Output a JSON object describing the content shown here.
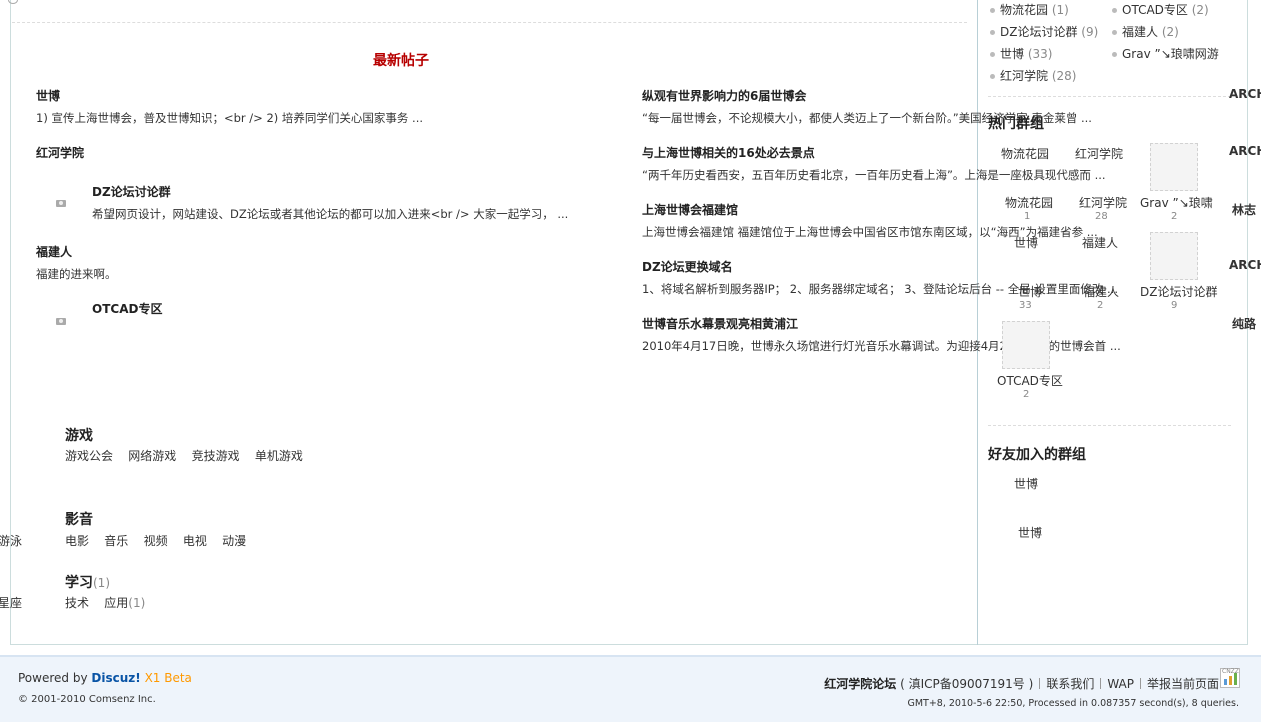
{
  "left": {
    "new_posts_title": "最新帖子",
    "posts_left": [
      {
        "title": "世博",
        "desc": "1) 宣传上海世博会，普及世博知识；<br /> 2) 培养同学们关心国家事务 ..."
      },
      {
        "title": "红河学院",
        "desc": ""
      },
      {
        "title": "DZ论坛讨论群",
        "desc": "希望网页设计，网站建设、DZ论坛或者其他论坛的都可以加入进来<br /> 大家一起学习， ..."
      },
      {
        "title": "福建人",
        "desc": "福建的进来啊。"
      },
      {
        "title": "OTCAD专区",
        "desc": ""
      }
    ],
    "posts_right": [
      {
        "title": "纵观有世界影响力的6届世博会",
        "desc": "“每一届世博会，不论规模大小，都使人类迈上了一个新台阶。”美国经济学家 麦金莱曾 ..."
      },
      {
        "title": "与上海世博相关的16处必去景点",
        "desc": "“两千年历史看西安，五百年历史看北京，一百年历史看上海”。上海是一座极具现代感而 ..."
      },
      {
        "title": "上海世博会福建馆",
        "desc": "上海世博会福建馆 福建馆位于上海世博会中国省区市馆东南区域，以“海西”为福建省参 ..."
      },
      {
        "title": "DZ论坛更换域名",
        "desc": "1、将域名解析到服务器IP； 2、服务器绑定域名； 3、登陆论坛后台 -- 全局 设置里面修改 ..."
      },
      {
        "title": "世博音乐水幕景观亮相黄浦江",
        "desc": "2010年4月17日晚，世博永久场馆进行灯光音乐水幕调试。为迎接4月20日进行的世博会首 ..."
      }
    ],
    "categories": [
      {
        "title": "游戏",
        "count": "",
        "items": [
          "游戏公会",
          "网络游戏",
          "竞技游戏",
          "单机游戏"
        ]
      },
      {
        "title": "影音",
        "count": "",
        "items": [
          "电影",
          "音乐",
          "视频",
          "电视",
          "动漫"
        ]
      },
      {
        "title": "学习",
        "count": "(1)",
        "items": [
          "技术",
          "应用"
        ],
        "item_counts": [
          "",
          "(1)"
        ]
      }
    ],
    "edge_text": [
      "游泳",
      "星座"
    ]
  },
  "side": {
    "group_list": [
      {
        "name": "物流花园",
        "count": "(1)"
      },
      {
        "name": "OTCAD专区",
        "count": "(2)"
      },
      {
        "name": "DZ论坛讨论群",
        "count": "(9)"
      },
      {
        "name": "福建人",
        "count": "(2)"
      },
      {
        "name": "世博",
        "count": "(33)"
      },
      {
        "name": "Grav ”↘琅啸网游",
        "count": ""
      },
      {
        "name": "红河学院",
        "count": "(28)"
      }
    ],
    "hot_groups_title": "热门群组",
    "hot_top_row": [
      "物流花园",
      "红河学院"
    ],
    "hot_groups": [
      {
        "name": "物流花园",
        "count": "1"
      },
      {
        "name": "红河学院",
        "count": "28"
      },
      {
        "name": "Grav ”↘琅啸",
        "count": "2"
      },
      {
        "name": "世博",
        "count": "33"
      },
      {
        "name": "福建人",
        "count": "2"
      },
      {
        "name": "DZ论坛讨论群",
        "count": "9"
      },
      {
        "name": "OTCAD专区",
        "count": "2"
      }
    ],
    "overlap_labels": [
      "世博",
      "福建人"
    ],
    "friends_title": "好友加入的群组",
    "friend_groups": [
      "世博",
      "世博"
    ],
    "edge_text": [
      "ARCH",
      "ARCH",
      "林志",
      "ARCH",
      "纯路"
    ]
  },
  "footer": {
    "powered_by": "Powered by",
    "brand": "Discuz!",
    "version": "X1 Beta",
    "copyright": "© 2001-2010 Comsenz Inc.",
    "site_name": "红河学院论坛",
    "icp": "( 滇ICP备09007191号 )",
    "links": [
      "联系我们",
      "WAP",
      "举报当前页面"
    ],
    "stats": "GMT+8, 2010-5-6 22:50, Processed in 0.087357 second(s), 8 queries.",
    "stat_icon_label": "CNZZ"
  }
}
